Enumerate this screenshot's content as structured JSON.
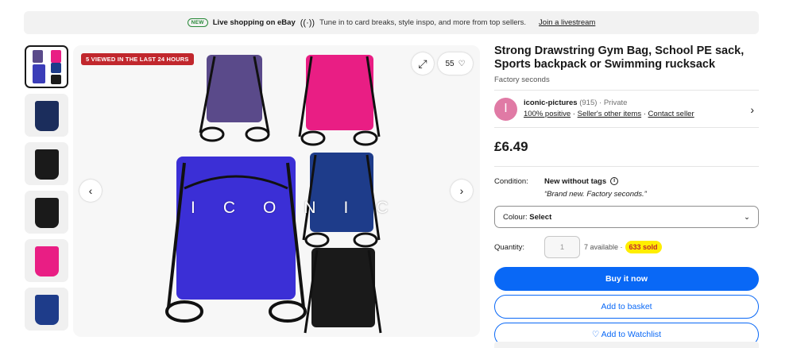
{
  "banner": {
    "badge": "NEW",
    "title": "Live shopping on eBay",
    "text": "Tune in to card breaks, style inspo, and more from top sellers.",
    "link": "Join a livestream"
  },
  "gallery": {
    "viewed_badge": "5 VIEWED IN THE LAST 24 HOURS",
    "watch_count": "55",
    "watermark": "ICONIC",
    "thumb_colors": [
      "#3b3db8",
      "#1b2d5c",
      "#1a1a1a",
      "#1a1a1a",
      "#e91e84",
      "#1e3c8a"
    ]
  },
  "product": {
    "title": "Strong Drawstring Gym Bag, School PE sack, Sports backpack or Swimming rucksack",
    "subtitle": "Factory seconds"
  },
  "seller": {
    "avatar_letter": "I",
    "name": "iconic-pictures",
    "feedback_count": "(915)",
    "type": "· Private",
    "positive": "100% positive",
    "other_items": "Seller's other items",
    "contact": "Contact seller"
  },
  "price": "£6.49",
  "condition": {
    "label": "Condition:",
    "value": "New without tags",
    "note": "“Brand new. Factory seconds.”"
  },
  "colour": {
    "label": "Colour:",
    "value": "Select"
  },
  "quantity": {
    "label": "Quantity:",
    "value": "1",
    "available": "7 available ·",
    "sold": "633 sold"
  },
  "buttons": {
    "buy": "Buy it now",
    "basket": "Add to basket",
    "watchlist": "♡ Add to Watchlist"
  },
  "colors": {
    "primary": "#0968f6",
    "highlight": "#ffee00",
    "badge_red": "#c1272d"
  }
}
